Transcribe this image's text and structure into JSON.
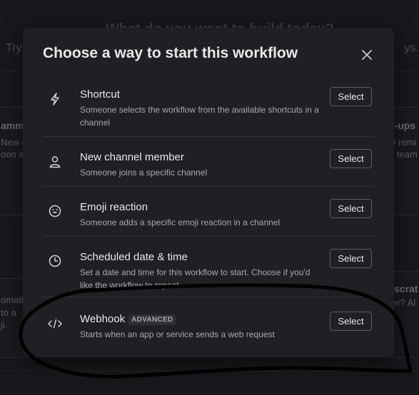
{
  "background": {
    "heading": "What do you want to build today?",
    "left_prompt": "Try",
    "right_prompt": "ys.",
    "cards": [
      {
        "title": "amm",
        "lines": [
          "New c",
          "oon as"
        ]
      },
      {
        "title": "d-ups",
        "lines": [
          "y remi",
          "r team"
        ]
      },
      {
        "title": "",
        "lines": [
          "omati",
          "to a",
          "ji."
        ]
      },
      {
        "title": "scrat",
        "lines": [
          "er? Al",
          ""
        ]
      }
    ]
  },
  "modal": {
    "title": "Choose a way to start this workflow",
    "close_icon": "close-icon",
    "options": [
      {
        "icon": "lightning-icon",
        "title": "Shortcut",
        "badge": "",
        "description": "Someone selects the workflow from the available shortcuts in a channel",
        "button": "Select"
      },
      {
        "icon": "person-icon",
        "title": "New channel member",
        "badge": "",
        "description": "Someone joins a specific channel",
        "button": "Select"
      },
      {
        "icon": "emoji-icon",
        "title": "Emoji reaction",
        "badge": "",
        "description": "Someone adds a specific emoji reaction in a channel",
        "button": "Select"
      },
      {
        "icon": "clock-icon",
        "title": "Scheduled date & time",
        "badge": "",
        "description": "Set a date and time for this workflow to start. Choose if you'd like the workflow to repeat.",
        "button": "Select"
      },
      {
        "icon": "code-icon",
        "title": "Webhook",
        "badge": "ADVANCED",
        "description": "Starts when an app or service sends a web request",
        "button": "Select"
      }
    ]
  },
  "colors": {
    "modal_bg": "#1f2024",
    "text_primary": "#e8e8e8",
    "text_secondary": "#a8a9ab",
    "divider": "#34353a",
    "annotation": "#000000"
  }
}
